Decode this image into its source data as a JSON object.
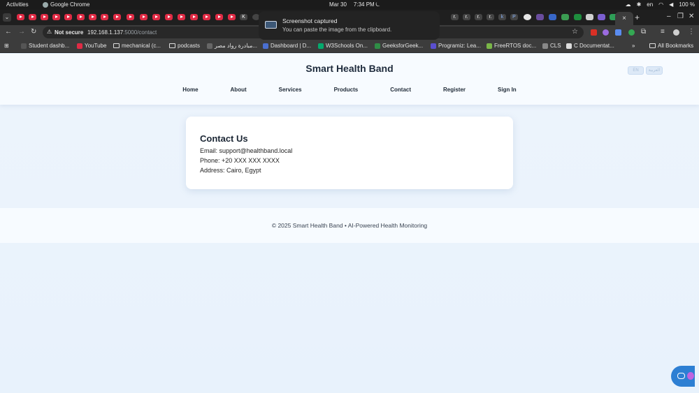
{
  "system": {
    "activities": "Activities",
    "app_name": "Google Chrome",
    "date": "Mar 30",
    "time": "7:34 PM",
    "lang": "en",
    "battery": "100 %"
  },
  "notification": {
    "title": "Screenshot captured",
    "body": "You can paste the image from the clipboard."
  },
  "tabs": {
    "letter_a": "K",
    "letter_b": "r.",
    "letter_c": "k",
    "letter_d": "P",
    "close_glyph": "×",
    "new_glyph": "+"
  },
  "omnibox": {
    "security": "Not secure",
    "host": "192.168.1.137",
    "path": ":5000/contact"
  },
  "bookmarks": {
    "items": [
      "Student dashb...",
      "YouTube",
      "mechanical (c...",
      "podcasts",
      "مبادرة رواد مصر...",
      "Dashboard | D...",
      "W3Schools On...",
      "GeeksforGeek...",
      "Programiz: Lea...",
      "FreeRTOS doc...",
      "CLS",
      "C Documentat..."
    ],
    "all": "All Bookmarks"
  },
  "site": {
    "title": "Smart Health Band",
    "lang_en": "EN",
    "lang_ar": "العربية",
    "nav": [
      "Home",
      "About",
      "Services",
      "Products",
      "Contact",
      "Register",
      "Sign In"
    ]
  },
  "contact": {
    "heading": "Contact Us",
    "email": "Email: support@healthband.local",
    "phone": "Phone: +20 XXX XXX XXXX",
    "address": "Address: Cairo, Egypt"
  },
  "footer": {
    "text": "© 2025 Smart Health Band • AI-Powered Health Monitoring"
  },
  "colors": {
    "tab_youtube": "#e02b45",
    "accent": "#2d7fd3",
    "page_bg": "#eaf3fc"
  }
}
